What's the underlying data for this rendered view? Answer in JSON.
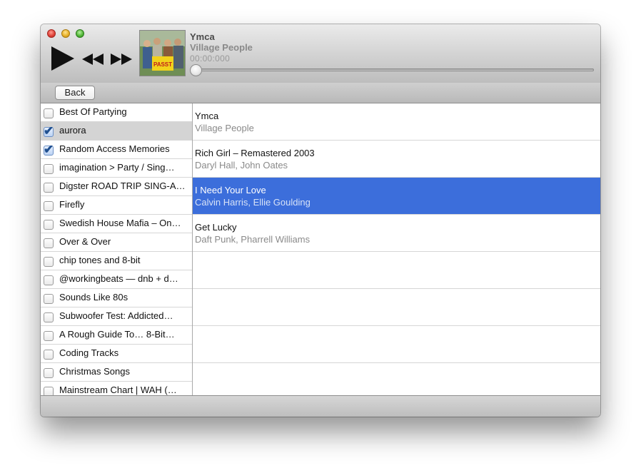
{
  "now_playing": {
    "title": "Ymca",
    "artist": "Village People",
    "time": "00:00:000",
    "progress": 0,
    "album_art_text": "PASST"
  },
  "toolbar": {
    "back_label": "Back"
  },
  "playlists": [
    {
      "label": "Best Of Partying",
      "checked": false,
      "selected": false
    },
    {
      "label": "aurora",
      "checked": true,
      "selected": true
    },
    {
      "label": "Random Access Memories",
      "checked": true,
      "selected": false
    },
    {
      "label": "imagination > Party / Sing…",
      "checked": false,
      "selected": false
    },
    {
      "label": "Digster ROAD TRIP SING-A…",
      "checked": false,
      "selected": false
    },
    {
      "label": "Firefly",
      "checked": false,
      "selected": false
    },
    {
      "label": "Swedish House Mafia – On…",
      "checked": false,
      "selected": false
    },
    {
      "label": "Over & Over",
      "checked": false,
      "selected": false
    },
    {
      "label": "chip tones and 8-bit",
      "checked": false,
      "selected": false
    },
    {
      "label": "@workingbeats — dnb + d…",
      "checked": false,
      "selected": false
    },
    {
      "label": "Sounds Like 80s",
      "checked": false,
      "selected": false
    },
    {
      "label": "Subwoofer Test: Addicted…",
      "checked": false,
      "selected": false
    },
    {
      "label": "A Rough Guide To… 8-Bit…",
      "checked": false,
      "selected": false
    },
    {
      "label": "Coding Tracks",
      "checked": false,
      "selected": false
    },
    {
      "label": "Christmas Songs",
      "checked": false,
      "selected": false
    },
    {
      "label": "Mainstream Chart | WAH (…",
      "checked": false,
      "selected": false
    }
  ],
  "songs": [
    {
      "title": "Ymca",
      "artist": "Village People",
      "selected": false
    },
    {
      "title": "Rich Girl – Remastered 2003",
      "artist": "Daryl Hall, John Oates",
      "selected": false
    },
    {
      "title": "I Need Your Love",
      "artist": "Calvin Harris, Ellie Goulding",
      "selected": true
    },
    {
      "title": "Get Lucky",
      "artist": "Daft Punk, Pharrell Williams",
      "selected": false
    }
  ],
  "colors": {
    "selection": "#3c6edb",
    "sidebar_selection": "#d4d4d4"
  },
  "icons": [
    "play-icon",
    "previous-icon",
    "next-icon",
    "checkmark-icon"
  ]
}
